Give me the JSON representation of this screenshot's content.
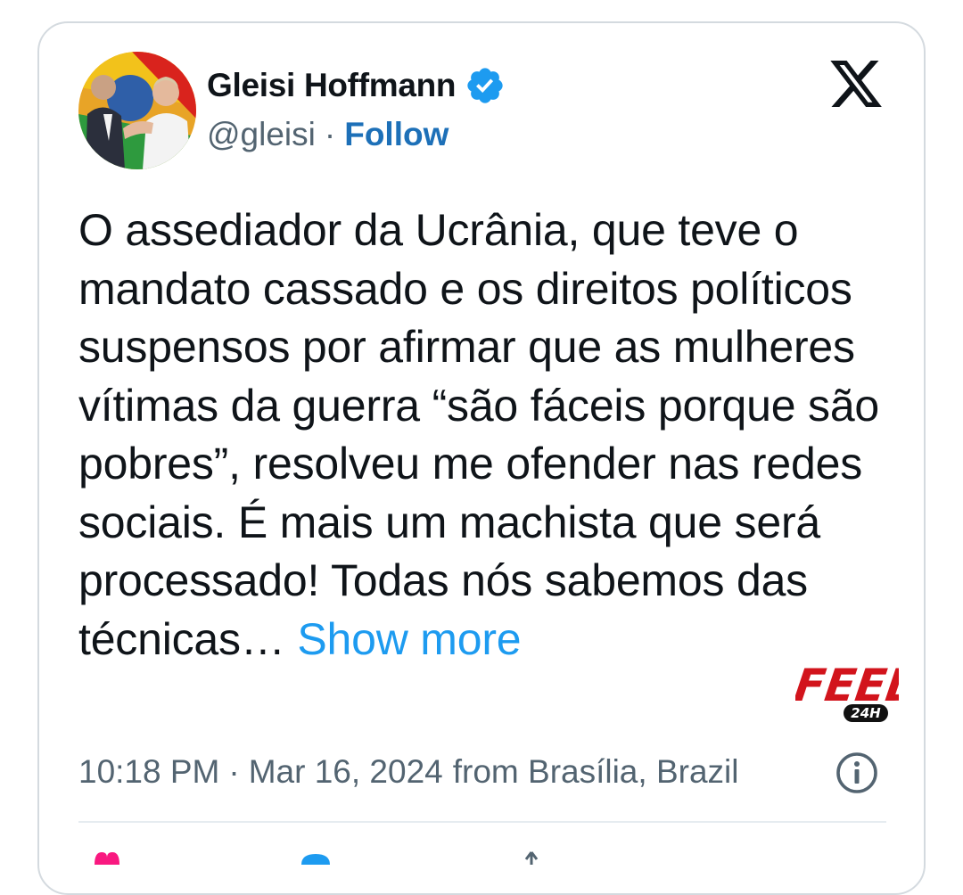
{
  "tweet": {
    "author": {
      "display_name": "Gleisi Hoffmann",
      "handle": "@gleisi",
      "separator": "·",
      "follow_label": "Follow",
      "verified": true,
      "avatar_icon": "profile-photo"
    },
    "text": "O assediador da Ucrânia, que teve o mandato cassado e os direitos políticos suspensos por afirmar que as mulheres vítimas da guerra “são fáceis porque são pobres”, resolveu me ofender nas redes sociais. É mais um machista que será processado! Todas nós sabemos das técnicas…",
    "show_more_label": "Show more",
    "time": "10:18 PM",
    "meta_separator": "·",
    "date": "Mar 16, 2024",
    "location": "from Brasília, Brazil"
  },
  "watermark": {
    "top": "FEED",
    "bottom": "24H"
  },
  "colors": {
    "text": "#0f1419",
    "secondary": "#536471",
    "link": "#1d9bf0",
    "verified": "#1d9bf0",
    "watermark": "#d2141c"
  }
}
